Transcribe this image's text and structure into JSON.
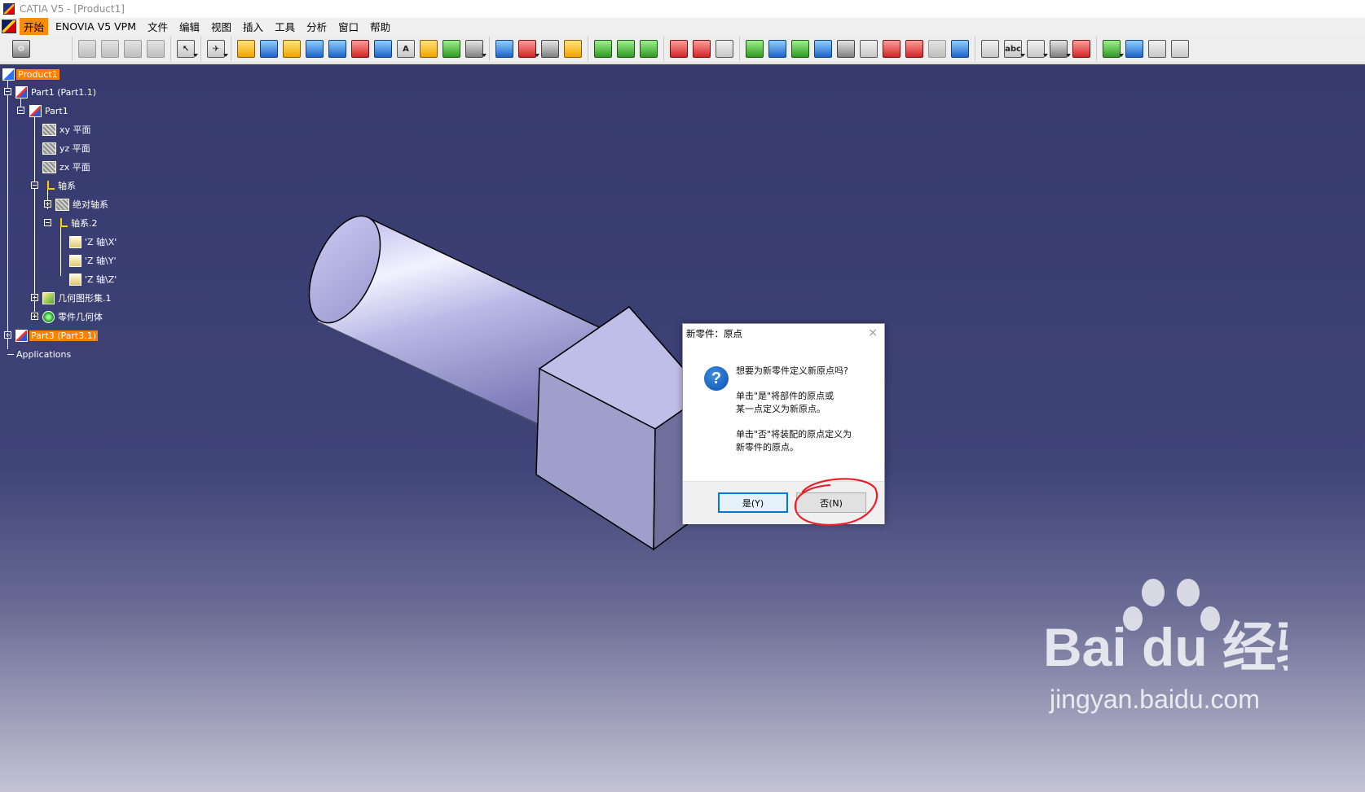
{
  "window": {
    "title": "CATIA V5 - [Product1]"
  },
  "menubar": {
    "items": [
      "开始",
      "ENOVIA V5 VPM",
      "文件",
      "编辑",
      "视图",
      "插入",
      "工具",
      "分析",
      "窗口",
      "帮助"
    ],
    "active_index": 0
  },
  "toolbar": {
    "icons": [
      "gears-icon",
      "part-icon",
      "product-icon",
      "component-icon",
      "select-icon",
      "fly-icon",
      "assembly-icons",
      "constraint-icons",
      "analysis-icons",
      "measure-icons",
      "view-icons"
    ]
  },
  "tree": {
    "product": "Product1",
    "part1_instance": "Part1 (Part1.1)",
    "part1": "Part1",
    "xy_plane": "xy 平面",
    "yz_plane": "yz 平面",
    "zx_plane": "zx 平面",
    "axis_system_group": "轴系",
    "absolute_axis": "绝对轴系",
    "axis_system_2": "轴系.2",
    "axis_x": "'Z 轴\\X'",
    "axis_y": "'Z 轴\\Y'",
    "axis_z": "'Z 轴\\Z'",
    "geometric_set": "几何图形集.1",
    "part_body": "零件几何体",
    "part3_instance": "Part3 (Part3.1)",
    "applications": "Applications"
  },
  "dialog": {
    "title": "新零件：原点",
    "close_label": "×",
    "question_icon": "?",
    "line1": "想要为新零件定义新原点吗?",
    "line2": "单击\"是\"将部件的原点或",
    "line3": "某一点定义为新原点。",
    "line4": "单击\"否\"将装配的原点定义为",
    "line5": "新零件的原点。",
    "yes_label": "是(Y)",
    "no_label": "否(N)",
    "highlight_color": "#e8202a"
  },
  "watermark": {
    "brand": "Bai du 经验",
    "url": "jingyan.baidu.com"
  },
  "colors": {
    "selection": "#ff8000",
    "viewport_top": "#363a6e",
    "viewport_bottom": "#c4c2d4"
  }
}
